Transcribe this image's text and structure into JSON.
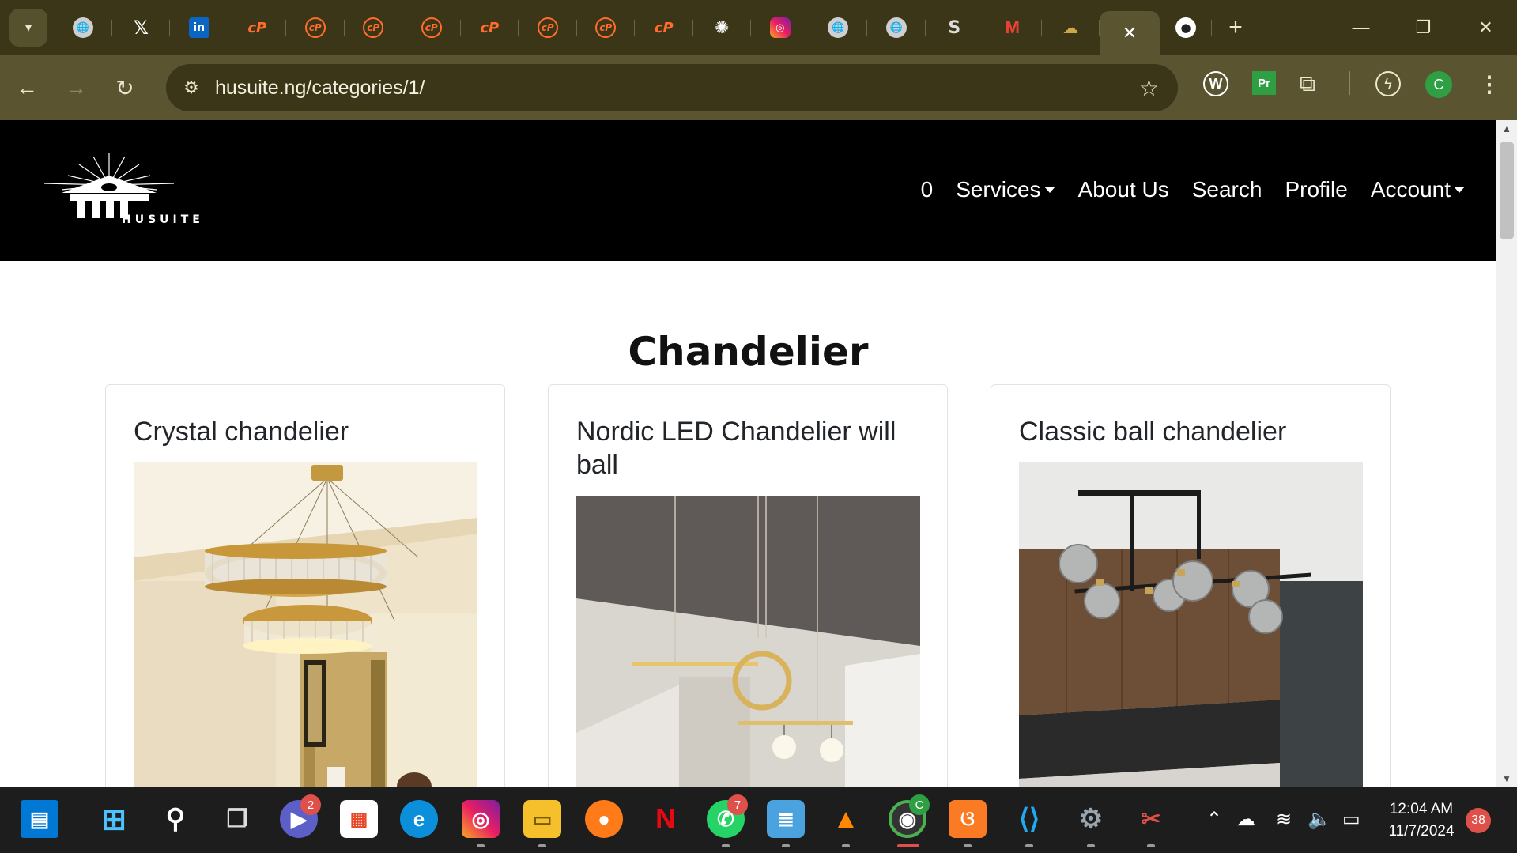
{
  "browser": {
    "tabs": [
      {
        "icon": "globe-icon",
        "glyph": "🌐"
      },
      {
        "icon": "x-icon",
        "glyph": "𝕏"
      },
      {
        "icon": "linkedin-icon",
        "glyph": "in"
      },
      {
        "icon": "cpanel-icon",
        "glyph": "cP"
      },
      {
        "icon": "cpanel-icon",
        "glyph": "cP"
      },
      {
        "icon": "cpanel-icon",
        "glyph": "cP"
      },
      {
        "icon": "cpanel-icon",
        "glyph": "cP"
      },
      {
        "icon": "cpanel-icon",
        "glyph": "cP"
      },
      {
        "icon": "cpanel-icon",
        "glyph": "cP"
      },
      {
        "icon": "cpanel-icon",
        "glyph": "cP"
      },
      {
        "icon": "cpanel-icon",
        "glyph": "cP"
      },
      {
        "icon": "chatgpt-icon",
        "glyph": "✺"
      },
      {
        "icon": "instagram-icon",
        "glyph": "◎"
      },
      {
        "icon": "globe-icon",
        "glyph": "🌐"
      },
      {
        "icon": "globe-icon",
        "glyph": "🌐"
      },
      {
        "icon": "stackoverflow-icon",
        "glyph": "S"
      },
      {
        "icon": "gmail-icon",
        "glyph": "M"
      },
      {
        "icon": "cloud-icon",
        "glyph": "☁"
      }
    ],
    "active_tab_close": "✕",
    "github_tab_glyph": "●",
    "new_tab": "+",
    "window_controls": {
      "minimize": "—",
      "restore": "❐",
      "close": "✕"
    },
    "url": "husuite.ng/categories/1/",
    "profile_initial": "C",
    "extensions": {
      "w": "W",
      "pr": "Pr"
    }
  },
  "site": {
    "logo_text": "HUSUITE",
    "nav": {
      "cart_count": "0",
      "services": "Services",
      "about": "About Us",
      "search": "Search",
      "profile": "Profile",
      "account": "Account"
    },
    "page_title": "Chandelier",
    "products": [
      {
        "title": "Crystal chandelier"
      },
      {
        "title": "Nordic LED Chandelier will ball"
      },
      {
        "title": "Classic ball chandelier"
      }
    ]
  },
  "taskbar": {
    "teams_badge": "2",
    "whatsapp_badge": "7",
    "chrome_profile": "C",
    "time": "12:04 AM",
    "date": "11/7/2024",
    "notifications": "38"
  },
  "colors": {
    "tabbar": "#3a3617",
    "toolbar": "#5a5530",
    "site_nav": "#000000",
    "taskbar": "#1d1d1d"
  }
}
